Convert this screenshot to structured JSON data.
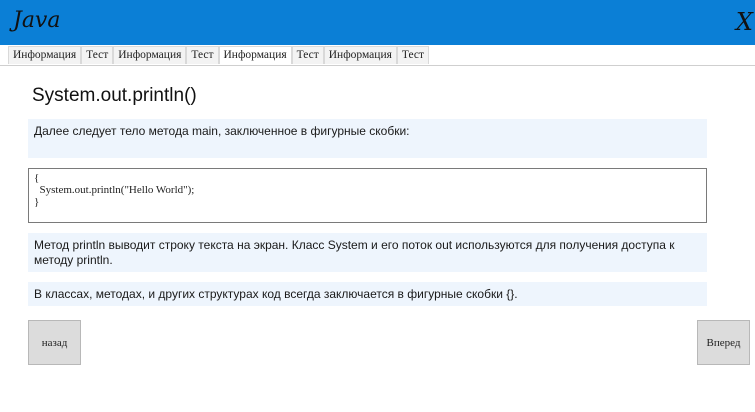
{
  "window": {
    "title": "Java",
    "close_label": "X"
  },
  "tabs": [
    {
      "label": "Информация"
    },
    {
      "label": "Тест"
    },
    {
      "label": "Информация"
    },
    {
      "label": "Тест"
    },
    {
      "label": "Информация"
    },
    {
      "label": "Тест"
    },
    {
      "label": "Информация"
    },
    {
      "label": "Тест"
    }
  ],
  "active_tab_index": 4,
  "content": {
    "title": "System.out.println()",
    "intro": "Далее следует тело метода main, заключенное в фигурные скобки:",
    "code": "{\n  System.out.println(\"Hello World\");\n}",
    "explanation": "Метод println выводит строку текста на экран. Класс System и его поток out используются для получения доступа к методу println.",
    "note": "В классах, методах, и других структурах код всегда заключается в фигурные скобки {}."
  },
  "nav": {
    "back_label": "назад",
    "forward_label": "Вперед"
  }
}
